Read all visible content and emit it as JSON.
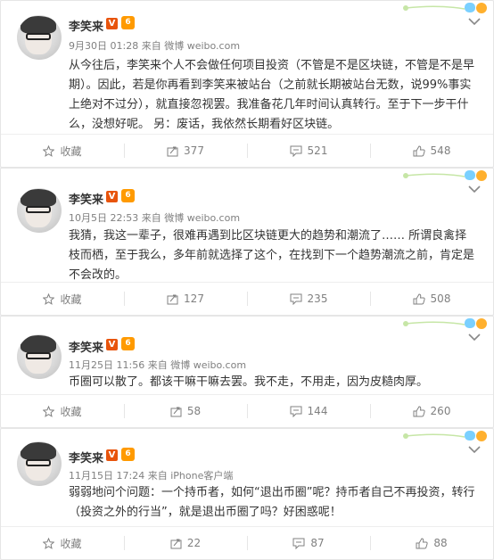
{
  "posts": [
    {
      "author": "李笑来",
      "badge_v": "V",
      "badge_level": "6",
      "time": "9月30日 01:28",
      "source_prefix": "来自",
      "source": "微博 weibo.com",
      "text": "从今往后，李笑来个人不会做任何项目投资（不管是不是区块链，不管是不是早期）。因此，若是你再看到李笑来被站台（之前就长期被站台无数，说99%事实上绝对不过分），就直接忽视罢。我准备花几年时间认真转行。至于下一步干什么，没想好呢。 另：废话，我依然长期看好区块链。",
      "favorite_label": "收藏",
      "reposts": "377",
      "comments": "521",
      "likes": "548"
    },
    {
      "author": "李笑来",
      "badge_v": "V",
      "badge_level": "6",
      "time": "10月5日 22:53",
      "source_prefix": "来自",
      "source": "微博 weibo.com",
      "text": "我猜，我这一辈子，很难再遇到比区块链更大的趋势和潮流了…… 所谓良禽择枝而栖，至于我么，多年前就选择了这个，在找到下一个趋势潮流之前，肯定是不会改的。",
      "favorite_label": "收藏",
      "reposts": "127",
      "comments": "235",
      "likes": "508"
    },
    {
      "author": "李笑来",
      "badge_v": "V",
      "badge_level": "6",
      "time": "11月25日 11:56",
      "source_prefix": "来自",
      "source": "微博 weibo.com",
      "text": "币圈可以散了。都该干嘛干嘛去罢。我不走，不用走，因为皮糙肉厚。",
      "favorite_label": "收藏",
      "reposts": "58",
      "comments": "144",
      "likes": "260"
    },
    {
      "author": "李笑来",
      "badge_v": "V",
      "badge_level": "6",
      "time": "11月15日 17:24",
      "source_prefix": "来自",
      "source": "iPhone客户端",
      "text": "弱弱地问个问题：一个持币者，如何“退出币圈”呢？持币者自己不再投资，转行（投资之外的行当”，就是退出币圈了吗？好困惑呢！",
      "favorite_label": "收藏",
      "reposts": "22",
      "comments": "87",
      "likes": "88"
    }
  ]
}
